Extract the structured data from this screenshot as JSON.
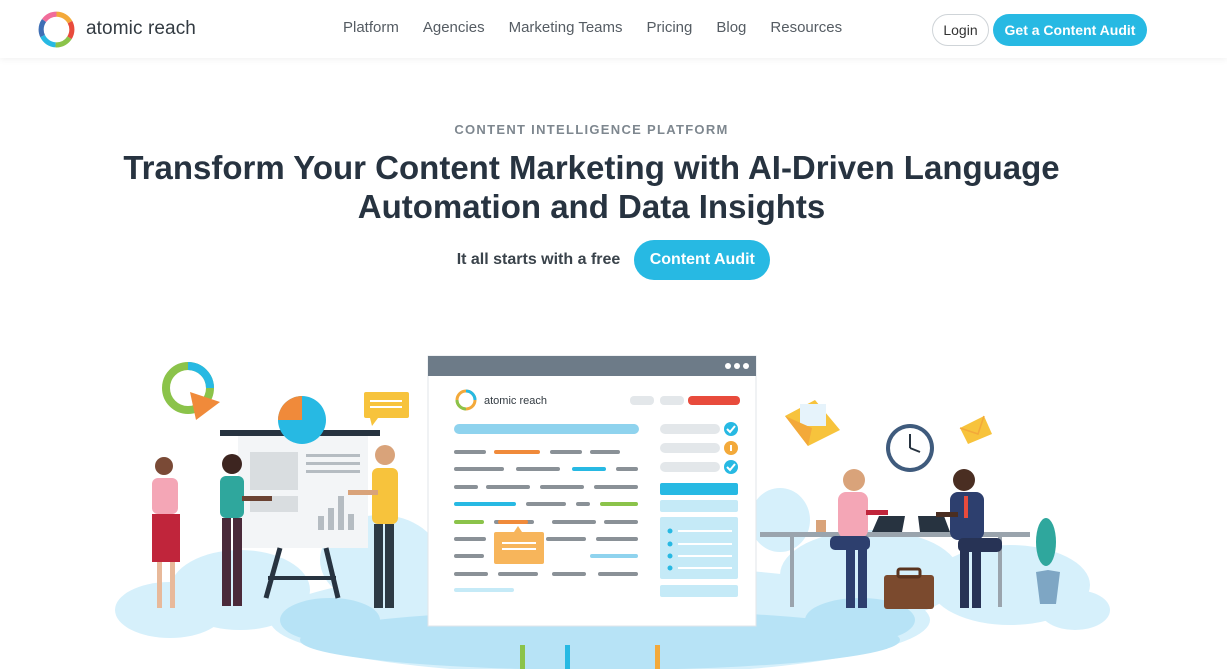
{
  "header": {
    "logo_text": "atomic reach",
    "nav": [
      "Platform",
      "Agencies",
      "Marketing Teams",
      "Pricing",
      "Blog",
      "Resources"
    ],
    "login_label": "Login",
    "cta_label": "Get a Content Audit"
  },
  "hero": {
    "eyebrow": "CONTENT INTELLIGENCE PLATFORM",
    "headline": "Transform Your Content Marketing with AI-Driven Language Automation and Data Insights",
    "sub_text": "It all starts with a free",
    "audit_button": "Content Audit"
  },
  "illustration": {
    "app_logo_text": "atomic reach"
  },
  "colors": {
    "accent": "#27b9e3",
    "heading": "#273340",
    "eyebrow": "#7e878f"
  }
}
